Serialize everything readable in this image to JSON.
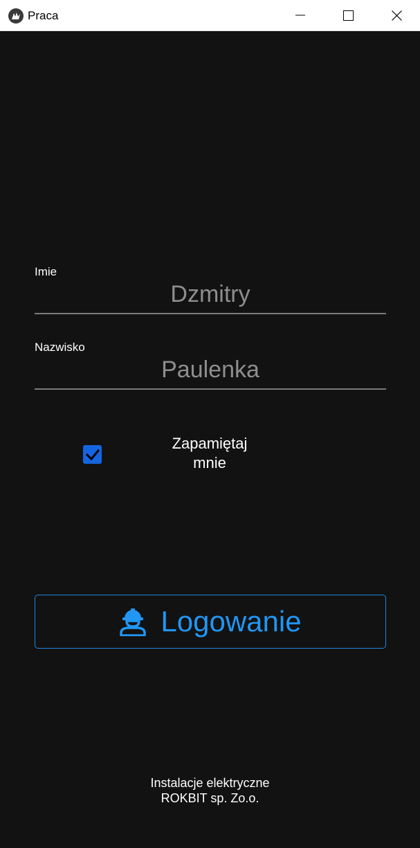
{
  "window": {
    "title": "Praca"
  },
  "form": {
    "first_name": {
      "label": "Imie",
      "value": "Dzmitry"
    },
    "last_name": {
      "label": "Nazwisko",
      "value": "Paulenka"
    },
    "remember": {
      "checked": true,
      "label_line1": "Zapamiętaj",
      "label_line2": "mnie"
    },
    "login_button": {
      "label": "Logowanie",
      "icon": "worker-hardhat-icon"
    }
  },
  "footer": {
    "line1": "Instalacje elektryczne",
    "line2": "ROKBIT sp. Zo.o."
  },
  "colors": {
    "background": "#121212",
    "accent": "#2196f3",
    "checkbox": "#1565e0",
    "field_text": "#8e8e8e"
  }
}
